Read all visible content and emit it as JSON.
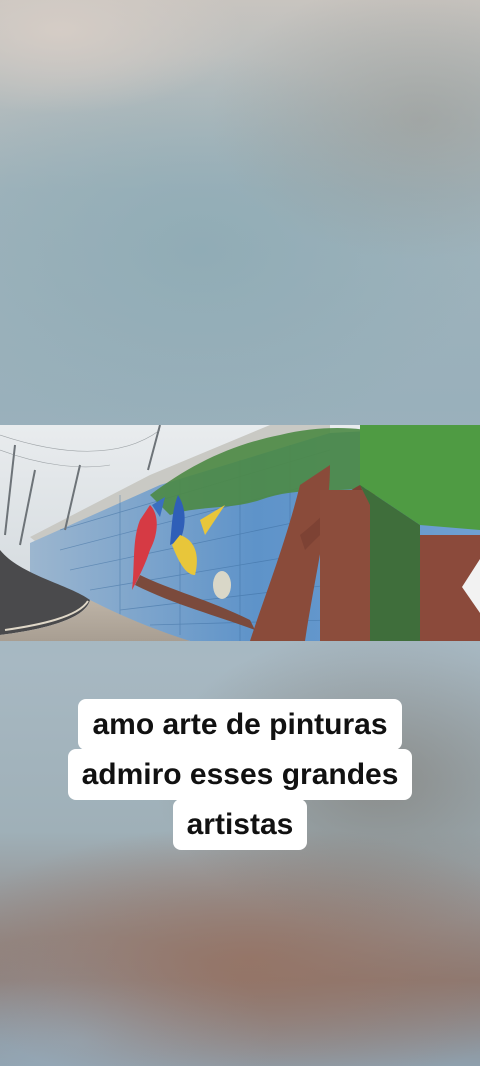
{
  "caption": {
    "lines": [
      "amo arte de pinturas",
      "admiro esses grandes",
      "artistas"
    ]
  },
  "media": {
    "description_icon": "street-mural-photo",
    "colors": {
      "sky": "#dfe3e6",
      "mural_blue": "#5b8fc7",
      "tree_trunk": "#8a4b3a",
      "foliage": "#3f8a3a",
      "road": "#4a4a4c"
    }
  }
}
